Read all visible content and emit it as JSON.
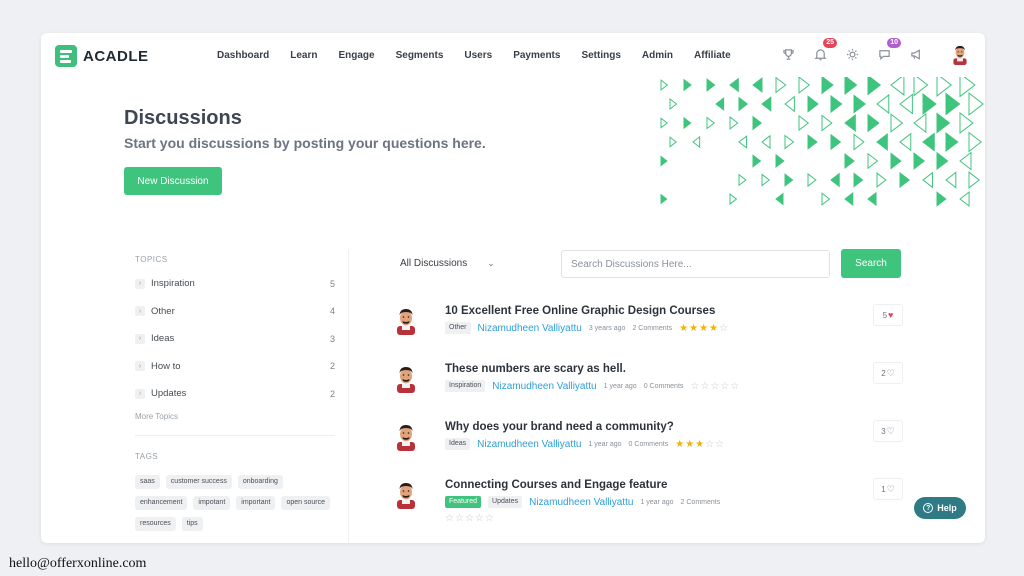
{
  "brand": {
    "name": "ACADLE",
    "accent": "#3fc47e"
  },
  "nav": [
    "Dashboard",
    "Learn",
    "Engage",
    "Segments",
    "Users",
    "Payments",
    "Settings",
    "Admin",
    "Affiliate"
  ],
  "header_icons": {
    "trophy": "trophy-icon",
    "notifications": {
      "icon": "bell-icon",
      "badge": "25"
    },
    "theme": "sun-icon",
    "messages": {
      "icon": "chat-icon",
      "badge": "10"
    },
    "announce": "megaphone-icon"
  },
  "hero": {
    "title": "Discussions",
    "subtitle": "Start you discussions by posting your questions here.",
    "button": "New Discussion"
  },
  "sidebar": {
    "topics_label": "TOPICS",
    "topics": [
      {
        "name": "Inspiration",
        "count": "5"
      },
      {
        "name": "Other",
        "count": "4"
      },
      {
        "name": "Ideas",
        "count": "3"
      },
      {
        "name": "How to",
        "count": "2"
      },
      {
        "name": "Updates",
        "count": "2"
      }
    ],
    "more_topics": "More Topics",
    "tags_label": "TAGS",
    "tags": [
      "saas",
      "customer success",
      "onboarding",
      "enhancement",
      "impotant",
      "important",
      "open source",
      "resources",
      "tips"
    ]
  },
  "filter": {
    "selected": "All Discussions"
  },
  "search": {
    "placeholder": "Search Discussions Here...",
    "button": "Search"
  },
  "discussions": [
    {
      "title": "10 Excellent Free Online Graphic Design Courses",
      "tags": [
        "Other"
      ],
      "author": "Nizamudheen Valliyattu",
      "time": "3 years ago",
      "comments": "2 Comments",
      "rating": 4,
      "likes": "5",
      "liked": true
    },
    {
      "title": "These numbers are scary as hell.",
      "tags": [
        "Inspiration"
      ],
      "author": "Nizamudheen Valliyattu",
      "time": "1 year ago",
      "comments": "0 Comments",
      "rating": 0,
      "likes": "2",
      "liked": false
    },
    {
      "title": "Why does your brand need a community?",
      "tags": [
        "Ideas"
      ],
      "author": "Nizamudheen Valliyattu",
      "time": "1 year ago",
      "comments": "0 Comments",
      "rating": 3,
      "likes": "3",
      "liked": false
    },
    {
      "title": "Connecting Courses and Engage feature",
      "featured": "Featured",
      "tags": [
        "Updates"
      ],
      "author": "Nizamudheen Valliyattu",
      "time": "1 year ago",
      "comments": "2 Comments",
      "rating": 0,
      "likes": "1",
      "liked": false
    }
  ],
  "help": {
    "label": "Help"
  },
  "footer": {
    "email": "hello@offerxonline.com"
  }
}
